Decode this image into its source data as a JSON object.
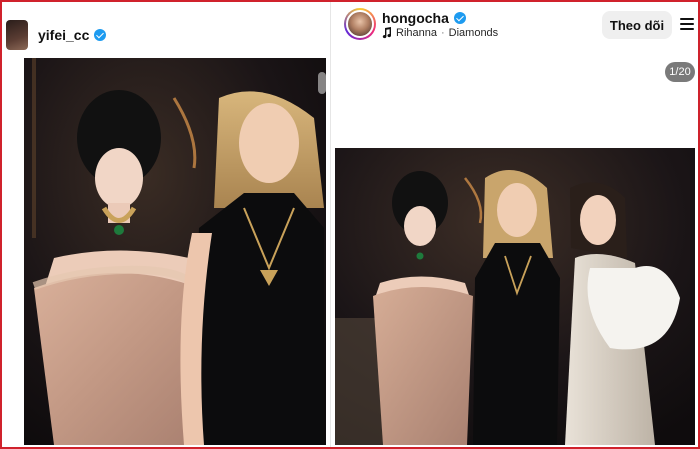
{
  "left_post": {
    "username": "yifei_cc",
    "verified": true,
    "photo_alt": "photo"
  },
  "right_post": {
    "username": "hongocha",
    "verified": true,
    "music_artist": "Rihanna",
    "music_separator": "·",
    "music_title": "Diamonds",
    "follow_label": "Theo dõi",
    "media_counter": "1/20"
  },
  "colors": {
    "frame": "#d0222c",
    "verified": "#1d9bf0",
    "follow_bg": "#efefef",
    "counter_bg": "#7a7a7a"
  },
  "icons": [
    "verified-badge-icon",
    "music-note-icon",
    "more-menu-icon"
  ]
}
